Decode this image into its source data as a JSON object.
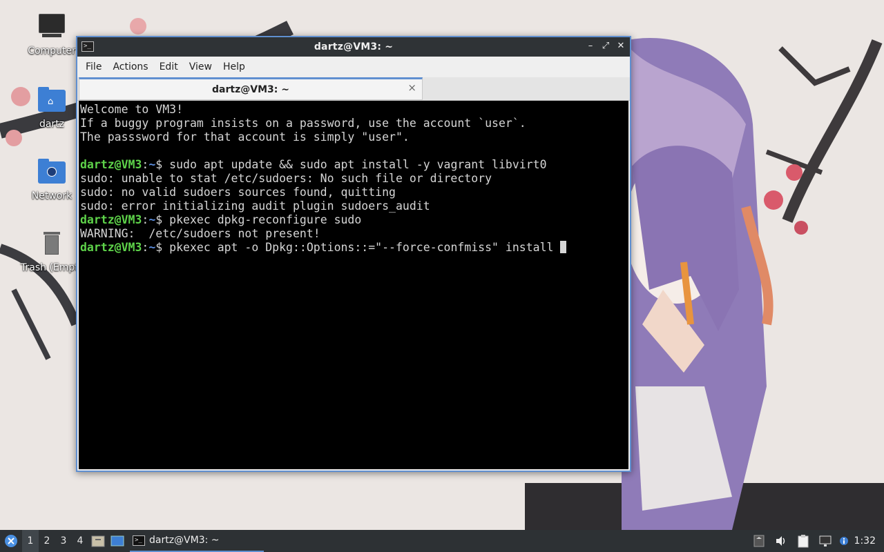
{
  "desktop": {
    "icons": [
      {
        "label": "Computer",
        "icon": "computer-icon"
      },
      {
        "label": "dartz",
        "icon": "home-folder-icon"
      },
      {
        "label": "Network",
        "icon": "network-folder-icon"
      },
      {
        "label": "Trash (Empty)",
        "icon": "trash-icon"
      }
    ]
  },
  "window": {
    "title": "dartz@VM3: ~",
    "menu": [
      "File",
      "Actions",
      "Edit",
      "View",
      "Help"
    ],
    "tab_label": "dartz@VM3: ~",
    "tab_close": "×",
    "controls": {
      "minimize": "–",
      "maximize": "⤢",
      "close": "✕"
    }
  },
  "terminal": {
    "lines": [
      {
        "text": "Welcome to VM3!"
      },
      {
        "text": "If a buggy program insists on a password, use the account `user`."
      },
      {
        "text": "The passsword for that account is simply \"user\"."
      },
      {
        "text": ""
      },
      {
        "user": "dartz@VM3",
        "sep": ":",
        "path": "~",
        "sym": "$ ",
        "cmd": "sudo apt update && sudo apt install -y vagrant libvirt0"
      },
      {
        "text": "sudo: unable to stat /etc/sudoers: No such file or directory"
      },
      {
        "text": "sudo: no valid sudoers sources found, quitting"
      },
      {
        "text": "sudo: error initializing audit plugin sudoers_audit"
      },
      {
        "user": "dartz@VM3",
        "sep": ":",
        "path": "~",
        "sym": "$ ",
        "cmd": "pkexec dpkg-reconfigure sudo"
      },
      {
        "text": "WARNING:  /etc/sudoers not present!"
      },
      {
        "user": "dartz@VM3",
        "sep": ":",
        "path": "~",
        "sym": "$ ",
        "cmd": "pkexec apt -o Dpkg::Options::=\"--force-confmiss\" install ",
        "cursor": true
      }
    ]
  },
  "taskbar": {
    "workspaces": [
      "1",
      "2",
      "3",
      "4"
    ],
    "active_workspace": 0,
    "task_label": "dartz@VM3: ~",
    "clock": "1:32"
  },
  "colors": {
    "accent": "#5f8fd0",
    "prompt_user": "#5ed34a",
    "prompt_path": "#5d8fe0",
    "terminal_bg": "#000000",
    "taskbar_bg": "#2d3134"
  }
}
